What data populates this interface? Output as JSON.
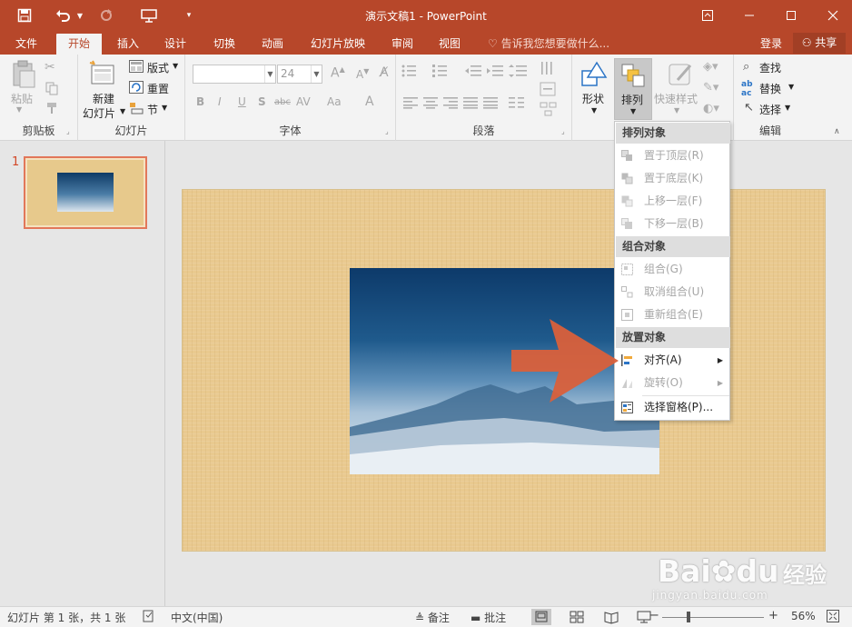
{
  "window": {
    "title": "演示文稿1 - PowerPoint"
  },
  "tabs": [
    "文件",
    "开始",
    "插入",
    "设计",
    "切换",
    "动画",
    "幻灯片放映",
    "审阅",
    "视图"
  ],
  "active_tab": "开始",
  "tell_me": "告诉我您想要做什么...",
  "account": {
    "login": "登录",
    "share": "共享"
  },
  "ribbon": {
    "clipboard": {
      "label": "剪贴板",
      "paste": "粘贴"
    },
    "slides": {
      "label": "幻灯片",
      "new_slide_1": "新建",
      "new_slide_2": "幻灯片",
      "layout": "版式",
      "reset": "重置",
      "section": "节"
    },
    "font": {
      "label": "字体",
      "font_name": "",
      "font_size": "24",
      "b": "B",
      "i": "I",
      "u": "U",
      "s": "S",
      "abc": "abc",
      "av": "AV",
      "aa": "Aa",
      "a": "A"
    },
    "paragraph": {
      "label": "段落"
    },
    "drawing": {
      "shape": "形状",
      "arrange": "排列",
      "quick_styles": "快速样式"
    },
    "editing": {
      "label": "编辑",
      "find": "查找",
      "replace": "替换",
      "select": "选择"
    }
  },
  "thumbnails": {
    "slide_number": "1"
  },
  "arrange_menu": {
    "section1": "排列对象",
    "bring_front": "置于顶层(R)",
    "send_back": "置于底层(K)",
    "bring_forward": "上移一层(F)",
    "send_backward": "下移一层(B)",
    "section2": "组合对象",
    "group": "组合(G)",
    "ungroup": "取消组合(U)",
    "regroup": "重新组合(E)",
    "section3": "放置对象",
    "align": "对齐(A)",
    "rotate": "旋转(O)",
    "selection_pane": "选择窗格(P)..."
  },
  "status": {
    "slide_info": "幻灯片 第 1 张，共 1 张",
    "language": "中文(中国)",
    "notes": "备注",
    "comments": "批注",
    "zoom": "56%",
    "zoom_fraction": 0.56
  },
  "watermark": {
    "brand": "Bai",
    "brand2": "du",
    "cn": "经验",
    "url": "jingyan.baidu.com"
  },
  "colors": {
    "accent": "#b7472a",
    "selection": "#e2775a",
    "arrow": "#d9603b"
  }
}
